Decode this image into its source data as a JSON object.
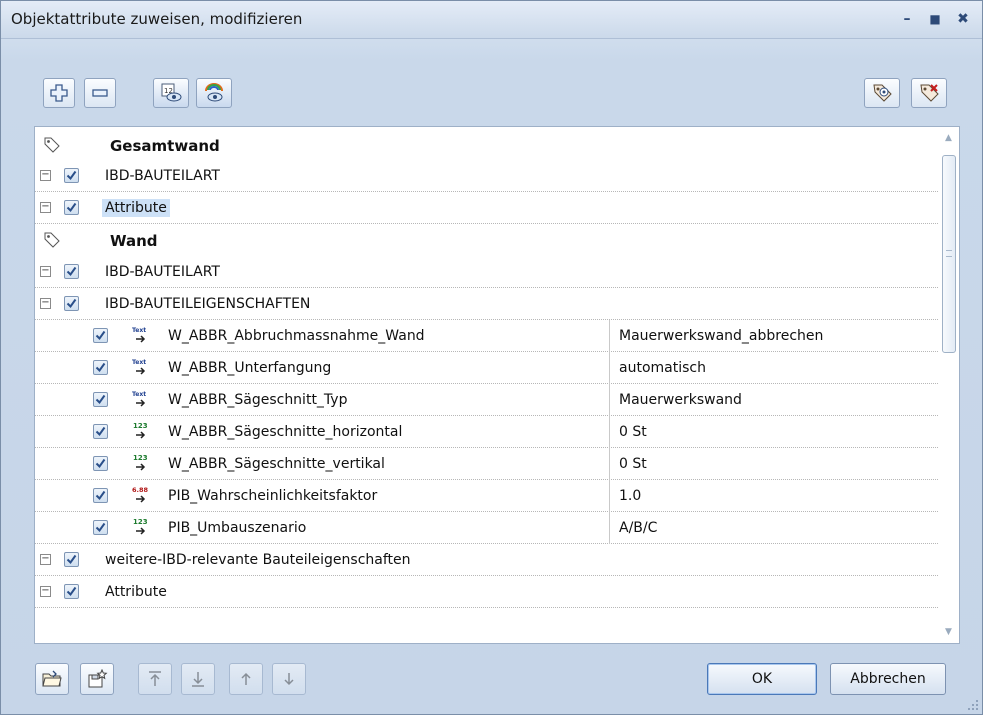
{
  "window": {
    "title": "Objektattribute zuweisen, modifizieren",
    "minimize_glyph": "–",
    "maximize_glyph": "■",
    "close_glyph": "✖"
  },
  "toolbar": {
    "left_icons": [
      "add-icon",
      "remove-icon",
      "show-numbered-icon",
      "show-visible-icon"
    ],
    "right_icons": [
      "add-favorite-icon",
      "remove-favorite-icon"
    ]
  },
  "tree": {
    "groups": [
      {
        "label": "Gesamtwand",
        "items": [
          {
            "label": "IBD-BAUTEILART",
            "checked": true,
            "expander": "⊟"
          },
          {
            "label": "Attribute",
            "checked": true,
            "expander": "⊟",
            "selected": true
          }
        ]
      },
      {
        "label": "Wand",
        "items": [
          {
            "label": "IBD-BAUTEILART",
            "checked": true,
            "expander": "⊟"
          },
          {
            "label": "IBD-BAUTEILEIGENSCHAFTEN",
            "checked": true,
            "expander": "⊟"
          }
        ],
        "attributes": [
          {
            "type_icon": "text-type-icon",
            "name": "W_ABBR_Abbruchmassnahme_Wand",
            "value": "Mauerwerkswand_abbrechen"
          },
          {
            "type_icon": "text-type-icon",
            "name": "W_ABBR_Unterfangung",
            "value": "automatisch"
          },
          {
            "type_icon": "text-type-icon",
            "name": "W_ABBR_Sägeschnitt_Typ",
            "value": "Mauerwerkswand"
          },
          {
            "type_icon": "integer-type-icon",
            "name": "W_ABBR_Sägeschnitte_horizontal",
            "value": "0 St"
          },
          {
            "type_icon": "integer-type-icon",
            "name": "W_ABBR_Sägeschnitte_vertikal",
            "value": "0 St"
          },
          {
            "type_icon": "decimal-type-icon",
            "name": "PIB_Wahrscheinlichkeitsfaktor",
            "value": "1.0"
          },
          {
            "type_icon": "integer-type-icon",
            "name": "PIB_Umbauszenario",
            "value": "A/B/C"
          }
        ],
        "trailing_items": [
          {
            "label": "weitere-IBD-relevante Bauteileigenschaften",
            "checked": true,
            "expander": "⊟"
          },
          {
            "label": "Attribute",
            "checked": true,
            "expander": "⊟"
          }
        ]
      }
    ],
    "type_icon_labels": {
      "text": "Text",
      "integer": "123",
      "decimal": "6.88"
    }
  },
  "footer": {
    "left_icons": [
      "open-folder-icon",
      "save-favorite-icon",
      "move-top-icon",
      "move-bottom-icon",
      "move-up-icon",
      "move-down-icon"
    ],
    "ok_label": "OK",
    "cancel_label": "Abbrechen"
  },
  "colors": {
    "accent": "#2d4a78",
    "selection": "#cde1f7",
    "checkmark": "#2a4f8a",
    "text_type": "#1f3f8f",
    "int_type": "#1b7a2c",
    "dec_type": "#b01515"
  }
}
